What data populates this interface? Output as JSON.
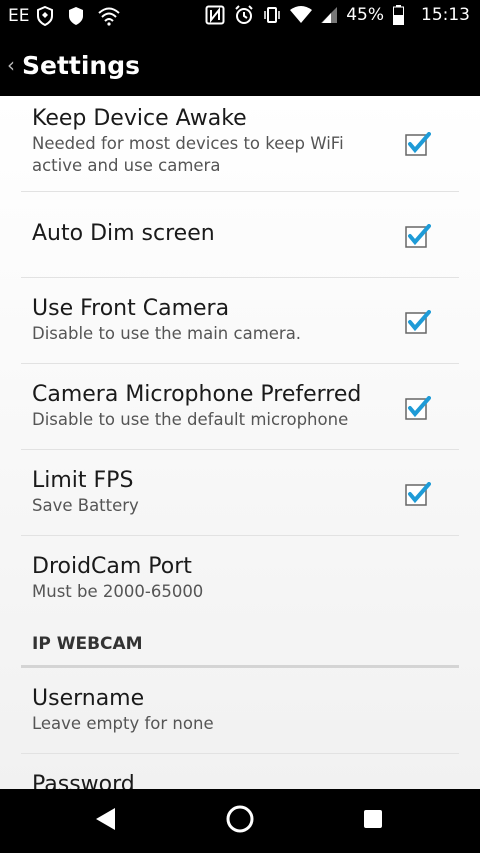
{
  "status_bar": {
    "carrier": "EE",
    "battery": "45%",
    "time": "15:13",
    "icons": [
      "shield-icon",
      "vpn-icon",
      "wifi-icon",
      "nfc-icon",
      "alarm-icon",
      "vibrate-icon",
      "wifi-signal-icon",
      "cell-signal-icon",
      "battery-icon"
    ]
  },
  "app_bar": {
    "title": "Settings"
  },
  "accent_color": "#1e9bd7",
  "settings": {
    "keep_awake": {
      "title": "Keep Device Awake",
      "summary": "Needed for most devices to keep WiFi active and use camera",
      "checked": true
    },
    "auto_dim": {
      "title": "Auto Dim screen",
      "checked": true
    },
    "front_camera": {
      "title": "Use Front Camera",
      "summary": "Disable to use the main camera.",
      "checked": true
    },
    "camera_mic": {
      "title": "Camera Microphone Preferred",
      "summary": "Disable to use the default microphone",
      "checked": true
    },
    "limit_fps": {
      "title": "Limit FPS",
      "summary": "Save Battery",
      "checked": true
    },
    "droidcam_port": {
      "title": "DroidCam Port",
      "summary": "Must be 2000-65000"
    },
    "ip_webcam_category": "IP WEBCAM",
    "username": {
      "title": "Username",
      "summary": "Leave empty for none"
    },
    "password": {
      "title": "Password"
    }
  },
  "nav_bar": {
    "icons": [
      "back-icon",
      "home-icon",
      "recents-icon"
    ]
  }
}
